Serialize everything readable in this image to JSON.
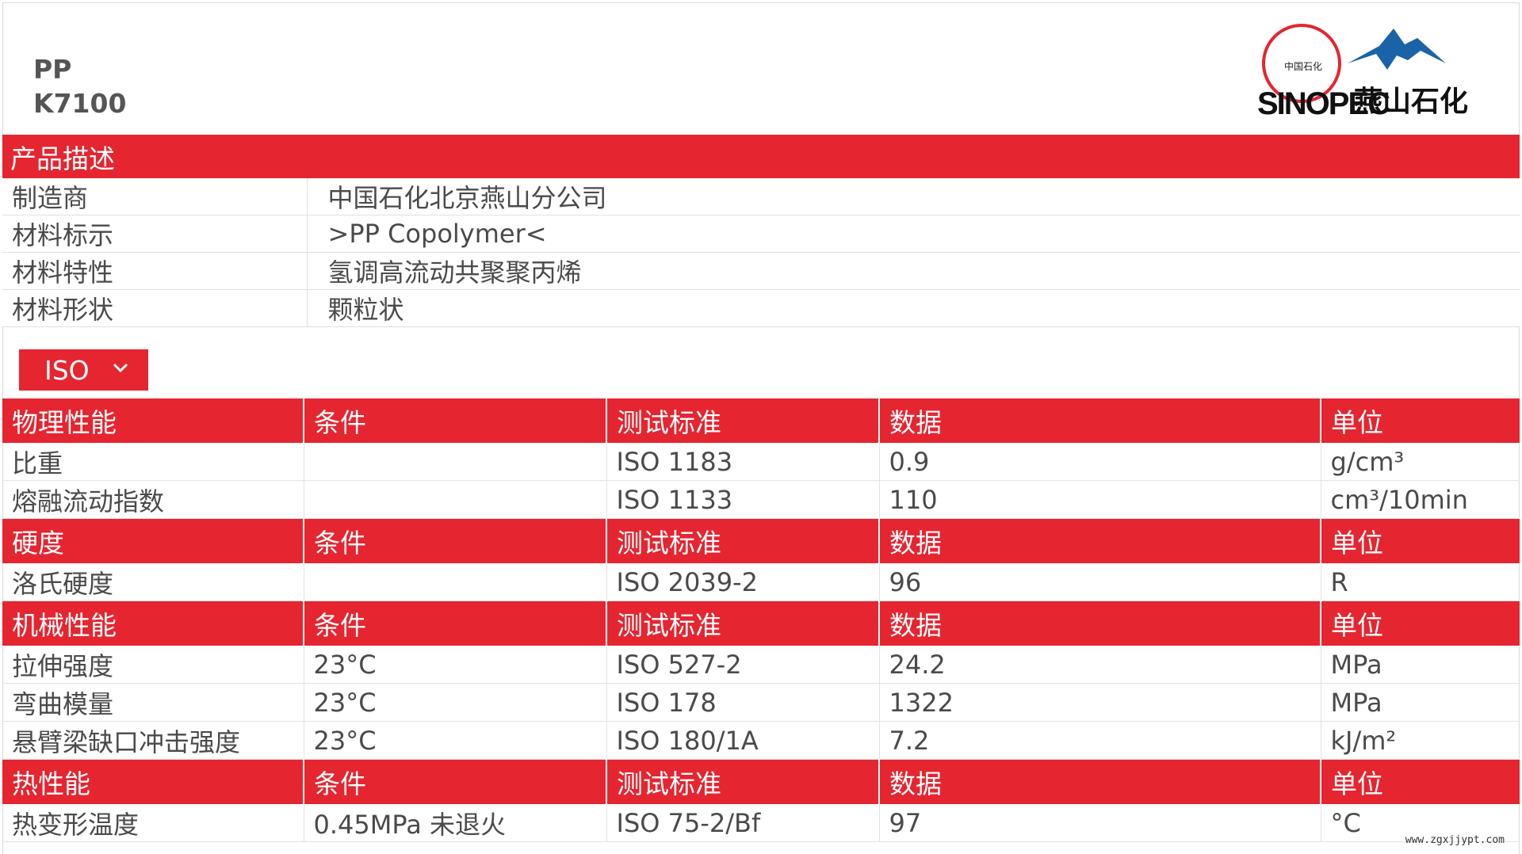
{
  "product": {
    "line1": "PP",
    "line2": "K7100"
  },
  "logo": {
    "brand_latin": "SINOPEC",
    "brand_small": "中国石化",
    "brand_cn": "燕山石化",
    "colors": {
      "red": "#e52530",
      "blue": "#1b63a8"
    }
  },
  "description": {
    "header": "产品描述",
    "rows": [
      {
        "key": "制造商",
        "value": "中国石化北京燕山分公司"
      },
      {
        "key": "材料标示",
        "value": ">PP Copolymer<"
      },
      {
        "key": "材料特性",
        "value": "氢调高流动共聚聚丙烯"
      },
      {
        "key": "材料形状",
        "value": "颗粒状"
      }
    ]
  },
  "standard_select": {
    "value": "ISO",
    "icon": "chevron-down-icon"
  },
  "sections": [
    {
      "headers": [
        "物理性能",
        "条件",
        "测试标准",
        "数据",
        "单位"
      ],
      "rows": [
        [
          "比重",
          "",
          "ISO 1183",
          "0.9",
          "g/cm³"
        ],
        [
          "熔融流动指数",
          "",
          "ISO 1133",
          "110",
          "cm³/10min"
        ]
      ]
    },
    {
      "headers": [
        "硬度",
        "条件",
        "测试标准",
        "数据",
        "单位"
      ],
      "rows": [
        [
          "洛氏硬度",
          "",
          "ISO 2039-2",
          "96",
          "R"
        ]
      ]
    },
    {
      "headers": [
        "机械性能",
        "条件",
        "测试标准",
        "数据",
        "单位"
      ],
      "rows": [
        [
          "拉伸强度",
          "23°C",
          "ISO 527-2",
          "24.2",
          "MPa"
        ],
        [
          "弯曲模量",
          "23°C",
          "ISO 178",
          "1322",
          "MPa"
        ],
        [
          "悬臂梁缺口冲击强度",
          "23°C",
          "ISO 180/1A",
          "7.2",
          "kJ/m²"
        ]
      ]
    },
    {
      "headers": [
        "热性能",
        "条件",
        "测试标准",
        "数据",
        "单位"
      ],
      "rows": [
        [
          "热变形温度",
          "0.45MPa 未退火",
          "ISO 75-2/Bf",
          "97",
          "°C"
        ]
      ]
    }
  ],
  "watermark": "www.zgxjjypt.com",
  "colors": {
    "accent": "#e52530",
    "text": "#4a4a4a",
    "border": "#e3e3e3"
  }
}
